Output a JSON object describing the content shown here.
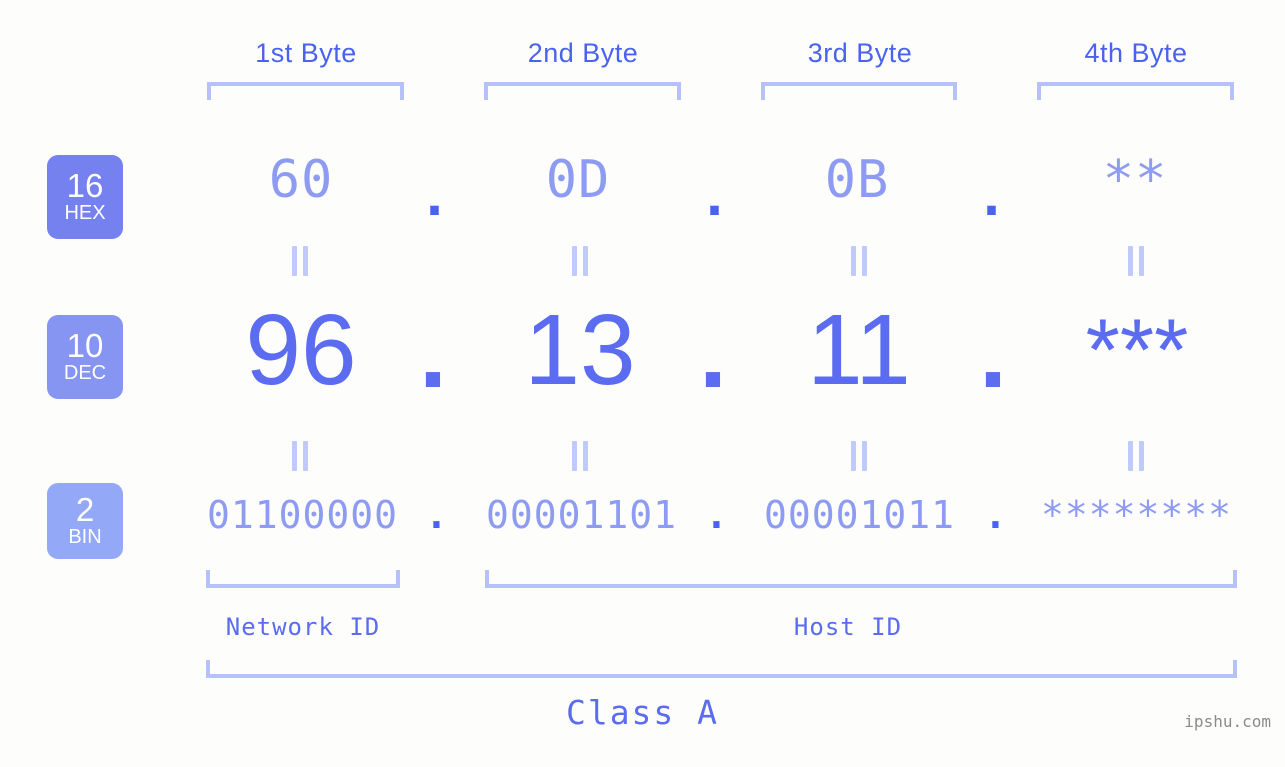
{
  "background_color": "#fdfdfb",
  "accent_colors": {
    "strong_blue": "#4a62f0",
    "dec_blue": "#5b6cf0",
    "light_blue": "#8d9bf3",
    "bracket": "#b6c0fb",
    "badge_hex": "#7481ee",
    "badge_dec": "#8694f2",
    "badge_bin": "#93a8f7"
  },
  "byte_headers": [
    {
      "label": "1st Byte"
    },
    {
      "label": "2nd Byte"
    },
    {
      "label": "3rd Byte"
    },
    {
      "label": "4th Byte"
    }
  ],
  "bases": [
    {
      "number": "16",
      "name": "HEX"
    },
    {
      "number": "10",
      "name": "DEC"
    },
    {
      "number": "2",
      "name": "BIN"
    }
  ],
  "rows": {
    "hex": {
      "base_number": "16",
      "base_name": "HEX",
      "values": [
        "60",
        "0D",
        "0B",
        "**"
      ],
      "separator": "."
    },
    "dec": {
      "base_number": "10",
      "base_name": "DEC",
      "values": [
        "96",
        "13",
        "11",
        "***"
      ],
      "separator": "."
    },
    "bin": {
      "base_number": "2",
      "base_name": "BIN",
      "values": [
        "01100000",
        "00001101",
        "00001011",
        "********"
      ],
      "separator": "."
    }
  },
  "equals_marks": {
    "symbol": "=",
    "count_per_row": 4
  },
  "id_sections": [
    {
      "label": "Network ID",
      "bytes": "1"
    },
    {
      "label": "Host ID",
      "bytes": "2-4"
    }
  ],
  "class_label": "Class A",
  "watermark": "ipshu.com"
}
